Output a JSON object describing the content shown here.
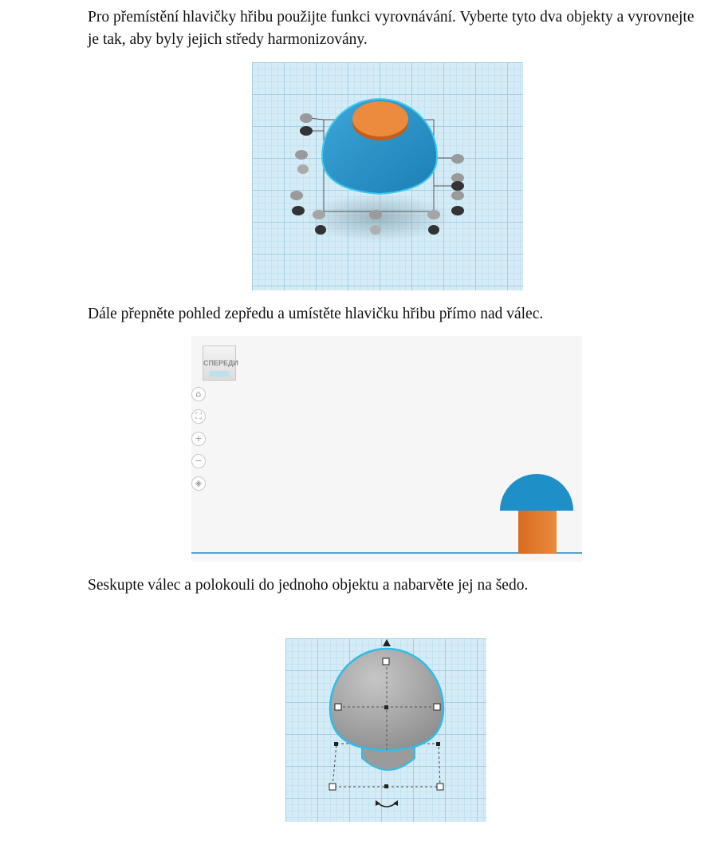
{
  "paragraphs": {
    "p1": "Pro přemístění hlavičky hřibu použijte funkci vyrovnávání. Vyberte tyto dva objekty a vyrovnejte je tak, aby byly jejich středy harmonizovány.",
    "p2": "Dále přepněte pohled zepředu a umístěte hlavičku hřibu přímo nad válec.",
    "p3": "Seskupte válec a polokouli do jednoho objektu a nabarvěte jej na šedo."
  },
  "figure2": {
    "view_cube_label": "СПЕРЕДИ",
    "view_buttons": [
      {
        "name": "home-icon",
        "glyph": "⌂"
      },
      {
        "name": "fit-view-icon",
        "glyph": "⛶"
      },
      {
        "name": "zoom-in-icon",
        "glyph": "+"
      },
      {
        "name": "zoom-out-icon",
        "glyph": "−"
      },
      {
        "name": "orthographic-icon",
        "glyph": "◈"
      }
    ]
  },
  "colors": {
    "blue": "#1d8fc8",
    "orange": "#e3782c",
    "gray": "#a3a3a3",
    "grid": "#d5ecf6"
  }
}
